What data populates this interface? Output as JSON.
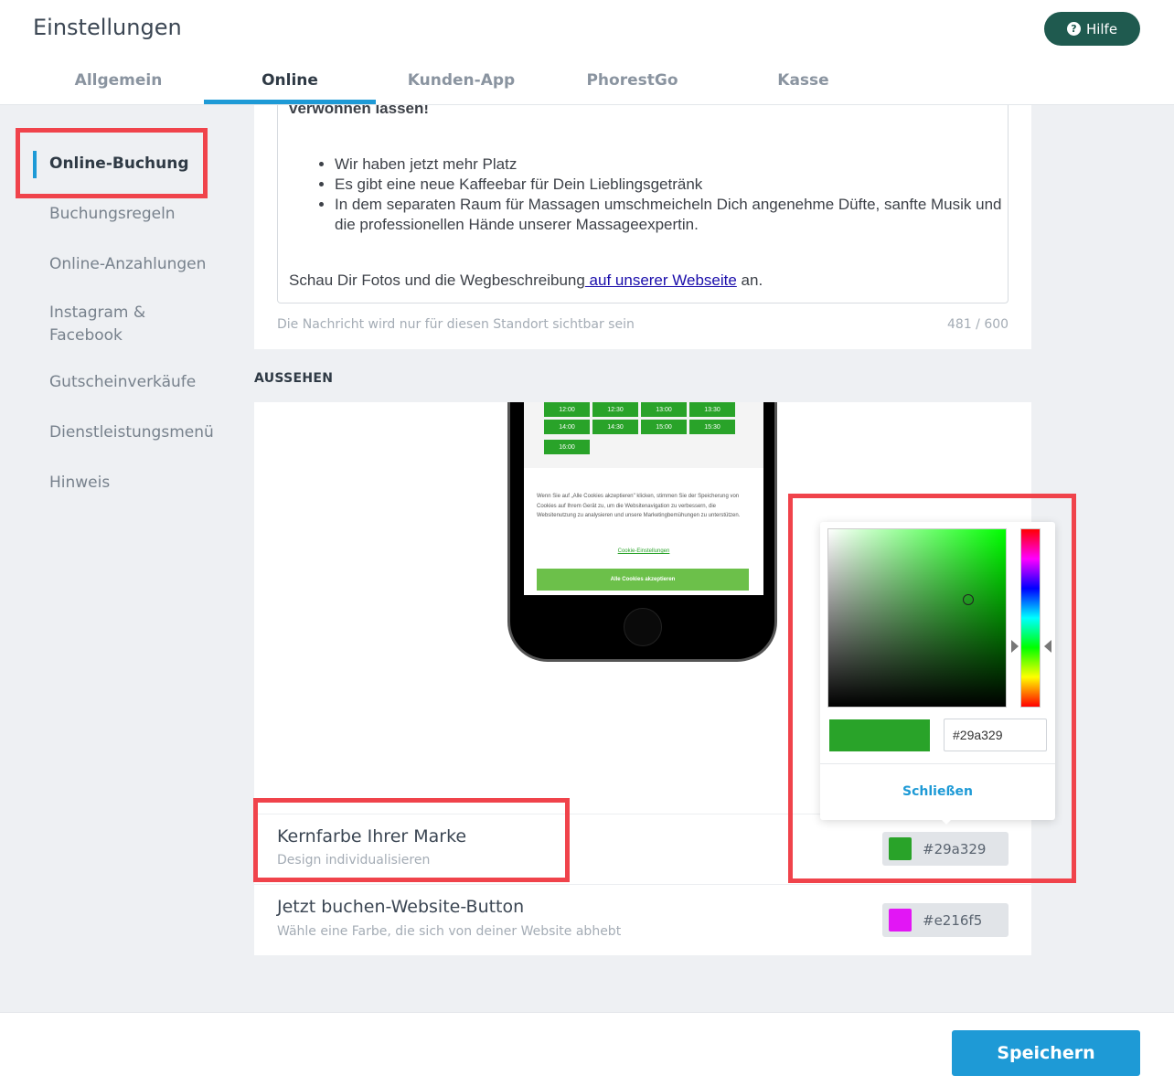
{
  "header": {
    "title": "Einstellungen",
    "help_label": "Hilfe",
    "help_icon": "question-circle-icon",
    "tabs": [
      "Allgemein",
      "Online",
      "Kunden-App",
      "PhorestGo",
      "Kasse"
    ],
    "active_tab": "Online"
  },
  "sidebar": {
    "items": [
      "Online-Buchung",
      "Buchungsregeln",
      "Online-Anzahlungen",
      "Instagram &",
      "Facebook",
      "Gutscheinverkäufe",
      "Dienstleistungsmenü",
      "Hinweis"
    ],
    "active_item": "Online-Buchung"
  },
  "message": {
    "partial_line": "verwöhnen lassen!",
    "bullets": [
      "Wir haben jetzt mehr Platz",
      "Es gibt eine neue Kaffeebar für Dein Lieblingsgetränk",
      "In dem separaten Raum für Massagen umschmeicheln Dich angenehme Düfte, sanfte Musik und die professionellen Hände unserer Massageexpertin."
    ],
    "footer_before": "Schau Dir Fotos und die Wegbeschreibung",
    "footer_link": " auf unserer Webseite",
    "footer_after": " an.",
    "visibility_hint": "Die Nachricht wird nur für diesen Standort sichtbar sein",
    "char_count": "481 / 600"
  },
  "appearance": {
    "section_label": "AUSSEHEN",
    "preview": {
      "time_slots": [
        "12:00",
        "12:30",
        "13:00",
        "13:30",
        "14:00",
        "14:30",
        "15:00",
        "15:30",
        "16:00"
      ],
      "cookie_text": "Wenn Sie auf „Alle Cookies akzeptieren\" klicken, stimmen Sie der Speicherung von Cookies auf Ihrem Gerät zu, um die Websitenavigation zu verbessern, die Websitenutzung zu analysieren und unsere Marketingbemühungen zu unterstützen.",
      "cookie_settings": "Cookie-Einstellungen",
      "cookie_accept": "Alle Cookies akzeptieren"
    },
    "brand_color": {
      "title": "Kernfarbe Ihrer Marke",
      "subtitle": "Design individualisieren",
      "value": "#29a329"
    },
    "booking_button": {
      "title": "Jetzt buchen-Website-Button",
      "subtitle": "Wähle eine Farbe, die sich von deiner Website abhebt",
      "value": "#e216f5"
    },
    "picker": {
      "hex_value": "#29a329",
      "close_label": "Schließen"
    }
  },
  "footer": {
    "save_label": "Speichern"
  },
  "colors": {
    "accent": "#1e9ad6",
    "help_button": "#1f5a4f",
    "highlight": "#f0434b"
  }
}
